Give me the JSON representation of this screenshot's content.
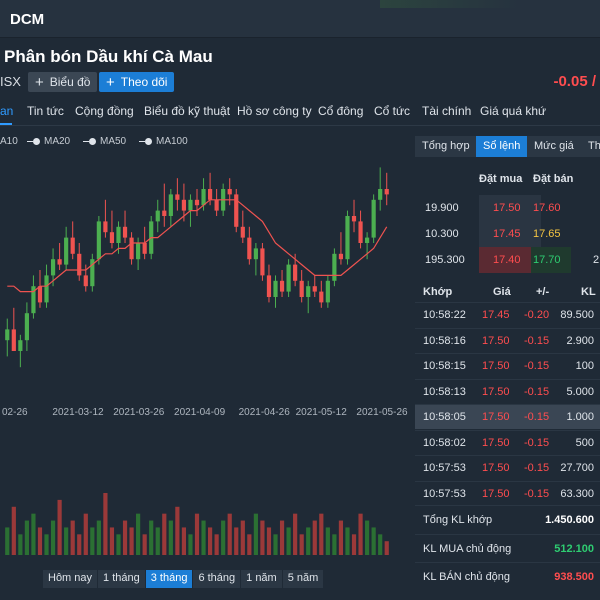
{
  "header": {
    "ticker": "DCM"
  },
  "company": {
    "name": "Phân bón Dầu khí Cà Mau",
    "exchange": "ISX",
    "chart_button": "Biểu đồ",
    "follow_button": "Theo dõi",
    "price_change": "-0.05 /"
  },
  "nav": {
    "tabs": [
      "an",
      "Tin tức",
      "Cộng đồng",
      "Biểu đồ kỹ thuật",
      "Hồ sơ công ty",
      "Cổ đông",
      "Cổ tức",
      "Tài chính",
      "Giá quá khứ"
    ],
    "active_index": 0
  },
  "legend": {
    "items": [
      "A10",
      "MA20",
      "MA50",
      "MA100"
    ]
  },
  "range_buttons": {
    "items": [
      "Hôm nay",
      "1 tháng",
      "3 tháng",
      "6 tháng",
      "1 năm",
      "5 năm"
    ],
    "active_index": 2
  },
  "colors": {
    "up": "#4caf50",
    "down": "#ef5350",
    "ma": "#ef5350",
    "accent": "#1c7ed6"
  },
  "chart_data": {
    "type": "candlestick",
    "x_tick_labels": [
      "02-26",
      "2021-03-12",
      "2021-03-26",
      "2021-04-09",
      "2021-04-26",
      "2021-05-12",
      "2021-05-26"
    ],
    "ohlc": [
      [
        14.2,
        14.6,
        13.9,
        14.4
      ],
      [
        14.4,
        14.8,
        14.1,
        14.0
      ],
      [
        14.0,
        14.3,
        13.7,
        14.2
      ],
      [
        14.2,
        14.9,
        14.0,
        14.7
      ],
      [
        14.7,
        15.4,
        14.6,
        15.2
      ],
      [
        15.2,
        15.5,
        14.8,
        14.9
      ],
      [
        14.9,
        15.6,
        14.8,
        15.4
      ],
      [
        15.4,
        15.9,
        15.2,
        15.7
      ],
      [
        15.7,
        16.0,
        15.5,
        15.6
      ],
      [
        15.6,
        16.3,
        15.5,
        16.1
      ],
      [
        16.1,
        16.4,
        15.7,
        15.8
      ],
      [
        15.8,
        16.0,
        15.3,
        15.4
      ],
      [
        15.4,
        15.6,
        15.1,
        15.2
      ],
      [
        15.2,
        15.8,
        15.1,
        15.7
      ],
      [
        15.7,
        16.5,
        15.6,
        16.4
      ],
      [
        16.4,
        16.8,
        16.1,
        16.2
      ],
      [
        16.2,
        16.6,
        15.9,
        16.0
      ],
      [
        16.0,
        16.4,
        15.8,
        16.3
      ],
      [
        16.3,
        16.6,
        16.0,
        16.1
      ],
      [
        16.1,
        16.2,
        15.6,
        15.7
      ],
      [
        15.7,
        16.1,
        15.5,
        16.0
      ],
      [
        16.0,
        16.3,
        15.7,
        15.8
      ],
      [
        15.8,
        16.5,
        15.7,
        16.4
      ],
      [
        16.4,
        16.8,
        16.2,
        16.6
      ],
      [
        16.6,
        17.1,
        16.3,
        16.5
      ],
      [
        16.5,
        17.0,
        16.3,
        16.9
      ],
      [
        16.9,
        17.2,
        16.6,
        16.8
      ],
      [
        16.8,
        17.1,
        16.4,
        16.6
      ],
      [
        16.6,
        16.9,
        16.3,
        16.8
      ],
      [
        16.8,
        17.0,
        16.5,
        16.7
      ],
      [
        16.7,
        17.2,
        16.6,
        17.0
      ],
      [
        17.0,
        17.3,
        16.7,
        16.8
      ],
      [
        16.8,
        17.0,
        16.5,
        16.6
      ],
      [
        16.6,
        17.1,
        16.5,
        17.0
      ],
      [
        17.0,
        17.2,
        16.7,
        16.9
      ],
      [
        16.9,
        17.0,
        16.2,
        16.3
      ],
      [
        16.3,
        16.6,
        16.0,
        16.1
      ],
      [
        16.1,
        16.3,
        15.6,
        15.7
      ],
      [
        15.7,
        16.0,
        15.4,
        15.9
      ],
      [
        15.9,
        16.0,
        15.3,
        15.4
      ],
      [
        15.4,
        15.6,
        14.9,
        15.0
      ],
      [
        15.0,
        15.4,
        14.8,
        15.3
      ],
      [
        15.3,
        15.5,
        15.0,
        15.1
      ],
      [
        15.1,
        15.7,
        15.0,
        15.6
      ],
      [
        15.6,
        15.8,
        15.2,
        15.3
      ],
      [
        15.3,
        15.5,
        14.9,
        15.0
      ],
      [
        15.0,
        15.3,
        14.7,
        15.2
      ],
      [
        15.2,
        15.4,
        15.0,
        15.1
      ],
      [
        15.1,
        15.3,
        14.8,
        14.9
      ],
      [
        14.9,
        15.4,
        14.8,
        15.3
      ],
      [
        15.3,
        15.9,
        15.2,
        15.8
      ],
      [
        15.8,
        16.2,
        15.6,
        15.7
      ],
      [
        15.7,
        16.6,
        15.6,
        16.5
      ],
      [
        16.5,
        16.8,
        16.2,
        16.4
      ],
      [
        16.4,
        16.6,
        15.9,
        16.0
      ],
      [
        16.0,
        16.2,
        15.7,
        16.1
      ],
      [
        16.1,
        16.9,
        16.0,
        16.8
      ],
      [
        16.8,
        17.4,
        16.6,
        17.0
      ],
      [
        17.0,
        17.3,
        16.7,
        16.9
      ]
    ],
    "ma": [
      15.2,
      15.2,
      15.1,
      15.1,
      15.1,
      15.2,
      15.2,
      15.3,
      15.4,
      15.5,
      15.5,
      15.5,
      15.5,
      15.6,
      15.7,
      15.8,
      15.8,
      15.9,
      15.9,
      16.0,
      16.0,
      16.0,
      16.1,
      16.1,
      16.2,
      16.3,
      16.4,
      16.5,
      16.6,
      16.6,
      16.7,
      16.8,
      16.8,
      16.8,
      16.8,
      16.8,
      16.7,
      16.6,
      16.5,
      16.4,
      16.2,
      16.0,
      15.9,
      15.8,
      15.7,
      15.6,
      15.5,
      15.4,
      15.4,
      15.4,
      15.4,
      15.4,
      15.5,
      15.6,
      15.7,
      15.8,
      15.9,
      16.1,
      16.3
    ],
    "volume": [
      4,
      7,
      3,
      5,
      6,
      4,
      3,
      5,
      8,
      4,
      5,
      3,
      6,
      4,
      5,
      9,
      4,
      3,
      5,
      4,
      6,
      3,
      5,
      4,
      6,
      5,
      7,
      4,
      3,
      6,
      5,
      4,
      3,
      5,
      6,
      4,
      5,
      3,
      6,
      5,
      4,
      3,
      5,
      4,
      6,
      3,
      4,
      5,
      6,
      4,
      3,
      5,
      4,
      3,
      6,
      5,
      4,
      3,
      2
    ],
    "ylim": [
      13.5,
      17.5
    ]
  },
  "right_panel": {
    "tabs": [
      "Tổng hợp",
      "Sổ lệnh",
      "Mức giá",
      "Th"
    ],
    "active_tab": 1,
    "orderbook_headers": {
      "bid": "Đặt mua",
      "ask": "Đặt bán"
    },
    "orderbook": [
      {
        "bid_vol": "19.900",
        "bid": "17.50",
        "ask": "17.60",
        "ask_vol": "",
        "bid_color": "#ff4d4f",
        "ask_color": "#ff4d4f",
        "bid_bg": "#2a3542",
        "ask_bg": ""
      },
      {
        "bid_vol": "10.300",
        "bid": "17.45",
        "ask": "17.65",
        "ask_vol": "",
        "bid_color": "#ff4d4f",
        "ask_color": "#f5c542",
        "bid_bg": "#2a3542",
        "ask_bg": ""
      },
      {
        "bid_vol": "195.300",
        "bid": "17.40",
        "ask": "17.70",
        "ask_vol": "2",
        "bid_color": "#ff4d4f",
        "ask_color": "#2ecc71",
        "bid_bg": "#5a2a32",
        "ask_bg": "#1f3a2e"
      }
    ],
    "trade_headers": [
      "Khớp",
      "Giá",
      "+/-",
      "KL"
    ],
    "trades": [
      {
        "time": "10:58:22",
        "price": "17.45",
        "change": "-0.20",
        "vol": "89.500"
      },
      {
        "time": "10:58:16",
        "price": "17.50",
        "change": "-0.15",
        "vol": "2.900"
      },
      {
        "time": "10:58:15",
        "price": "17.50",
        "change": "-0.15",
        "vol": "100"
      },
      {
        "time": "10:58:13",
        "price": "17.50",
        "change": "-0.15",
        "vol": "5.000"
      },
      {
        "time": "10:58:05",
        "price": "17.50",
        "change": "-0.15",
        "vol": "1.000"
      },
      {
        "time": "10:58:02",
        "price": "17.50",
        "change": "-0.15",
        "vol": "500"
      },
      {
        "time": "10:57:53",
        "price": "17.50",
        "change": "-0.15",
        "vol": "27.700"
      },
      {
        "time": "10:57:53",
        "price": "17.50",
        "change": "-0.15",
        "vol": "63.300"
      }
    ],
    "highlight_row": 4,
    "summary": {
      "total_label": "Tổng KL khớp",
      "total_value": "1.450.600",
      "buy_label": "KL MUA chủ động",
      "buy_value": "512.100",
      "sell_label": "KL BÁN chủ động",
      "sell_value": "938.500"
    }
  }
}
